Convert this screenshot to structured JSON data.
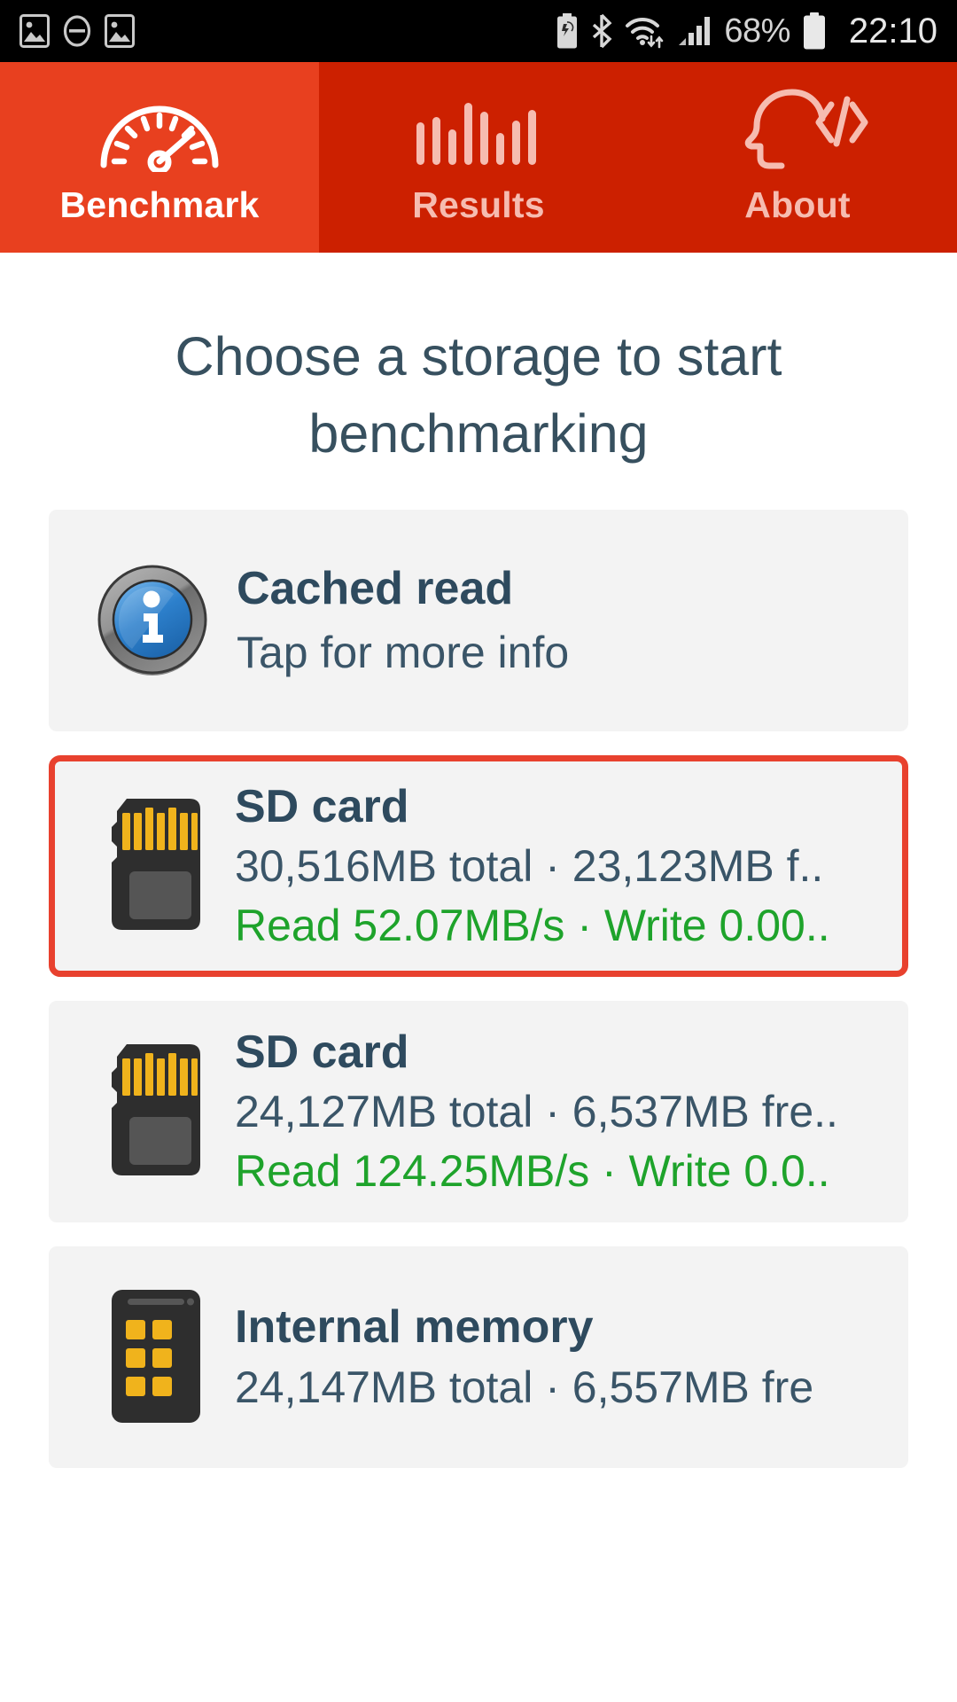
{
  "statusbar": {
    "icons_left": [
      "image-icon",
      "do-not-disturb-icon",
      "image-icon"
    ],
    "icons_right": [
      "battery-saver-icon",
      "bluetooth-icon",
      "wifi-icon",
      "cellular-signal-icon"
    ],
    "battery_percent": "68%",
    "time": "22:10"
  },
  "tabs": [
    {
      "label": "Benchmark",
      "icon": "speedometer-icon",
      "active": true
    },
    {
      "label": "Results",
      "icon": "bar-chart-icon",
      "active": false
    },
    {
      "label": "About",
      "icon": "head-code-icon",
      "active": false
    }
  ],
  "main": {
    "title": "Choose a storage to start benchmarking"
  },
  "storage_items": [
    {
      "icon": "info-icon",
      "title": "Cached read",
      "subtitle": "Tap for more info",
      "speed": "",
      "selected": false
    },
    {
      "icon": "sd-card-icon",
      "title": "SD card",
      "subtitle": "30,516MB total · 23,123MB f..",
      "speed": "Read 52.07MB/s · Write 0.00..",
      "selected": true
    },
    {
      "icon": "sd-card-icon",
      "title": "SD card",
      "subtitle": "24,127MB total · 6,537MB fre..",
      "speed": "Read 124.25MB/s · Write 0.0..",
      "selected": false
    },
    {
      "icon": "internal-memory-icon",
      "title": "Internal memory",
      "subtitle": "24,147MB total · 6,557MB fre",
      "speed": "",
      "selected": false
    }
  ],
  "colors": {
    "tab_active_bg": "#e8401f",
    "tab_inactive_bg": "#cc2000",
    "selection_border": "#e8412e",
    "text_dark": "#2e4a5e",
    "text_green": "#1ea32b",
    "card_bg": "#f3f3f3"
  }
}
